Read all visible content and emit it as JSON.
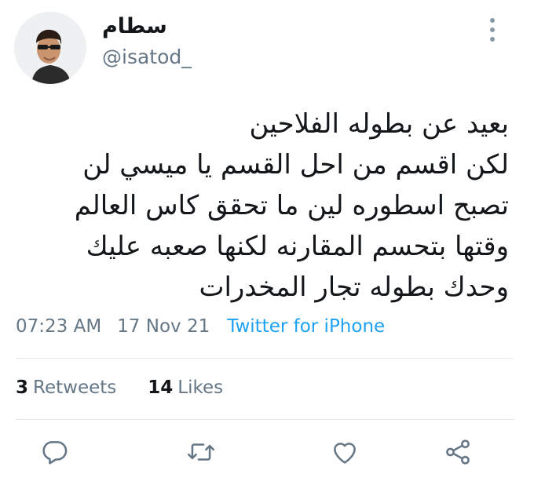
{
  "user": {
    "display_name": "سطام",
    "handle": "@isatod_"
  },
  "tweet": {
    "lines": [
      "بعيد عن بطوله الفلاحين",
      "لكن اقسم من احل القسم يا ميسي لن",
      "تصبح اسطوره لين ما تحقق كاس العالم",
      "وقتها بتحسم المقارنه لكنها صعبه عليك",
      "وحدك بطوله تجار المخدرات"
    ],
    "time": "07:23 AM",
    "date": "17 Nov 21",
    "source": "Twitter for iPhone"
  },
  "stats": {
    "retweets_count": "3",
    "retweets_label": "Retweets",
    "likes_count": "14",
    "likes_label": "Likes"
  },
  "icons": {
    "reply": "reply-icon",
    "retweet": "retweet-icon",
    "like": "heart-icon",
    "share": "share-icon",
    "more": "more-vertical-icon"
  },
  "colors": {
    "text": "#14171a",
    "secondary": "#657786",
    "link": "#1da1f2",
    "divider": "#e1e8ed",
    "icon": "#657786"
  }
}
